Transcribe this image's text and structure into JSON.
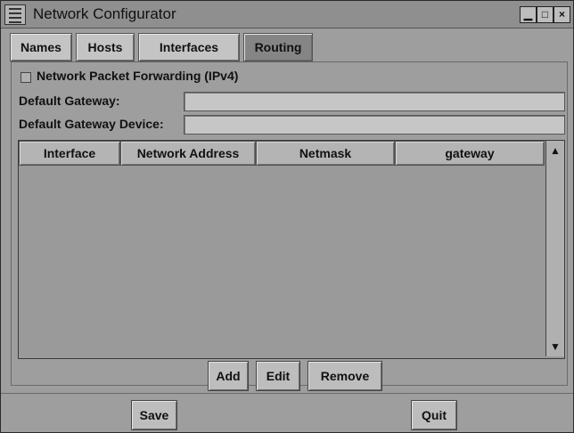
{
  "window": {
    "title": "Network Configurator",
    "controls": {
      "minimize": "▁",
      "maximize": "□",
      "close": "×"
    }
  },
  "tabs": [
    {
      "label": "Names"
    },
    {
      "label": "Hosts"
    },
    {
      "label": "Interfaces"
    },
    {
      "label": "Routing",
      "active": true
    }
  ],
  "routing": {
    "forwarding_label": "Network Packet Forwarding (IPv4)",
    "default_gateway_label": "Default Gateway:",
    "default_gateway_value": "",
    "default_gateway_device_label": "Default Gateway Device:",
    "default_gateway_device_value": ""
  },
  "table": {
    "columns": [
      "Interface",
      "Network Address",
      "Netmask",
      "gateway"
    ],
    "rows": []
  },
  "actions": {
    "add": "Add",
    "edit": "Edit",
    "remove": "Remove"
  },
  "footer": {
    "save": "Save",
    "quit": "Quit"
  },
  "icons": {
    "menu": "menu-icon",
    "scroll_up": "scroll-up-arrow-icon",
    "scroll_down": "scroll-down-arrow-icon"
  }
}
